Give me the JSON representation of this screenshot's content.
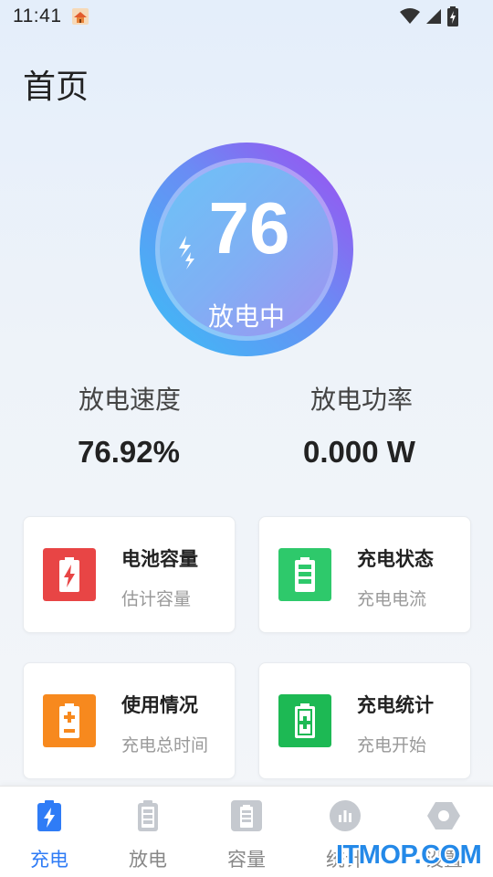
{
  "status_bar": {
    "time": "11:41"
  },
  "page": {
    "title": "首页"
  },
  "gauge": {
    "percent": "76",
    "state": "放电中",
    "level": 0.76
  },
  "metrics": [
    {
      "label": "放电速度",
      "value": "76.92%"
    },
    {
      "label": "放电功率",
      "value": "0.000 W"
    }
  ],
  "cards": [
    {
      "title": "电池容量",
      "subtitle": "估计容量",
      "color": "#e84545",
      "icon": "battery-bolt-icon"
    },
    {
      "title": "充电状态",
      "subtitle": "充电电流",
      "color": "#2ec96b",
      "icon": "battery-level-icon"
    },
    {
      "title": "使用情况",
      "subtitle": "充电总时间",
      "color": "#f7891e",
      "icon": "battery-plus-minus-icon"
    },
    {
      "title": "充电统计",
      "subtitle": "充电开始",
      "color": "#1db954",
      "icon": "battery-plus-icon"
    }
  ],
  "tabs": [
    {
      "label": "充电",
      "active": true,
      "icon": "charging-battery-icon"
    },
    {
      "label": "放电",
      "active": false,
      "icon": "battery-icon"
    },
    {
      "label": "容量",
      "active": false,
      "icon": "capacity-icon"
    },
    {
      "label": "统计",
      "active": false,
      "icon": "bar-chart-icon"
    },
    {
      "label": "设置",
      "active": false,
      "icon": "hexagon-icon"
    }
  ],
  "colors": {
    "accent": "#2f7cf6",
    "inactive": "#c5c9cf"
  },
  "watermark": "ITMOP.COM"
}
